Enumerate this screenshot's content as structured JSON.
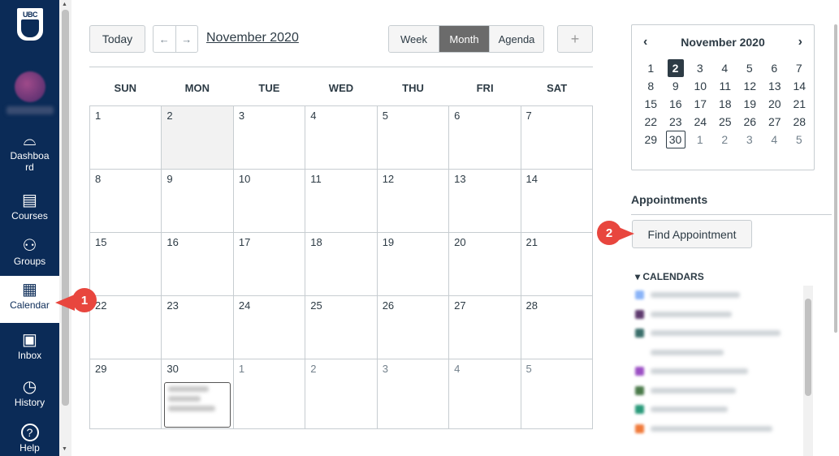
{
  "global_nav": {
    "logo_text": "UBC",
    "items": [
      {
        "icon": "dashboard-icon",
        "glyph": "⌓",
        "label": "Dashboa rd"
      },
      {
        "icon": "courses-icon",
        "glyph": "▤",
        "label": "Courses"
      },
      {
        "icon": "groups-icon",
        "glyph": "⚇",
        "label": "Groups"
      },
      {
        "icon": "calendar-icon",
        "glyph": "▦",
        "label": "Calendar"
      },
      {
        "icon": "inbox-icon",
        "glyph": "▣",
        "label": "Inbox"
      },
      {
        "icon": "history-icon",
        "glyph": "◷",
        "label": "History"
      },
      {
        "icon": "help-icon",
        "glyph": "?",
        "label": "Help"
      }
    ]
  },
  "toolbar": {
    "today_label": "Today",
    "prev_glyph": "←",
    "next_glyph": "→",
    "month_title": "November 2020",
    "views": [
      "Week",
      "Month",
      "Agenda"
    ],
    "selected_view": "Month",
    "add_glyph": "+"
  },
  "calendar": {
    "days_of_week": [
      "SUN",
      "MON",
      "TUE",
      "WED",
      "THU",
      "FRI",
      "SAT"
    ],
    "weeks": [
      [
        "1",
        "2",
        "3",
        "4",
        "5",
        "6",
        "7"
      ],
      [
        "8",
        "9",
        "10",
        "11",
        "12",
        "13",
        "14"
      ],
      [
        "15",
        "16",
        "17",
        "18",
        "19",
        "20",
        "21"
      ],
      [
        "22",
        "23",
        "24",
        "25",
        "26",
        "27",
        "28"
      ],
      [
        "29",
        "30",
        "1",
        "2",
        "3",
        "4",
        "5"
      ]
    ],
    "today": "2"
  },
  "mini_calendar": {
    "title": "November 2020",
    "prev_glyph": "‹",
    "next_glyph": "›",
    "weeks": [
      [
        "1",
        "2",
        "3",
        "4",
        "5",
        "6",
        "7"
      ],
      [
        "8",
        "9",
        "10",
        "11",
        "12",
        "13",
        "14"
      ],
      [
        "15",
        "16",
        "17",
        "18",
        "19",
        "20",
        "21"
      ],
      [
        "22",
        "23",
        "24",
        "25",
        "26",
        "27",
        "28"
      ],
      [
        "29",
        "30",
        "1",
        "2",
        "3",
        "4",
        "5"
      ]
    ]
  },
  "appointments": {
    "title": "Appointments",
    "find_label": "Find Appointment"
  },
  "calendars": {
    "header": "▾ CALENDARS",
    "colors": [
      "#8ab4f8",
      "#5e3a6e",
      "#3a6e6a",
      "#ffffff",
      "#9b4fc4",
      "#4a7a4a",
      "#2a9a7a",
      "#f07a3a"
    ]
  },
  "callouts": {
    "one": "1",
    "two": "2",
    "color": "#e8463e"
  }
}
